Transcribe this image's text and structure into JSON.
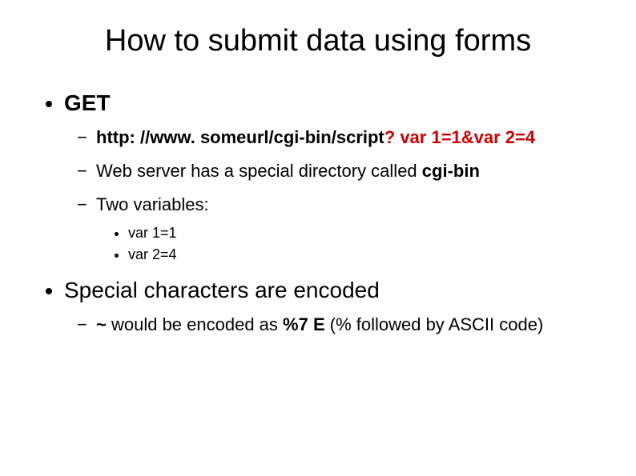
{
  "title": "How to submit data using forms",
  "items": [
    {
      "label": "GET",
      "bold": true,
      "children": [
        {
          "prefix_bold": "http: //www. someurl/cgi-bin/script",
          "suffix_red": "? var 1=1&var 2=4"
        },
        {
          "text_before": "Web server has a special directory called ",
          "text_bold": "cgi-bin"
        },
        {
          "text": "Two variables:",
          "children": [
            {
              "text": "var 1=1"
            },
            {
              "text": "var 2=4"
            }
          ]
        }
      ]
    },
    {
      "label": "Special characters are encoded",
      "children": [
        {
          "tilde": "~",
          "mid": " would be encoded as ",
          "pct": "%7 E",
          "after": " (% followed by ASCII code)"
        }
      ]
    }
  ]
}
